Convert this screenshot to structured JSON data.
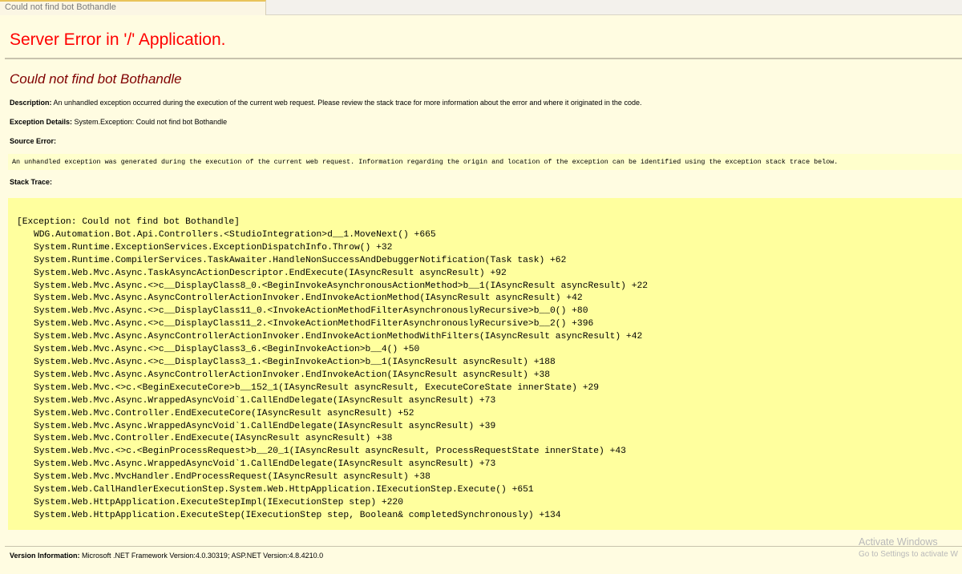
{
  "tab": {
    "title": "Could not find bot Bothandle"
  },
  "header": {
    "title": "Server Error in '/' Application."
  },
  "error": {
    "title": "Could not find bot Bothandle",
    "description_label": "Description:",
    "description_text": "An unhandled exception occurred during the execution of the current web request. Please review the stack trace for more information about the error and where it originated in the code.",
    "exception_label": "Exception Details:",
    "exception_text": "System.Exception: Could not find bot Bothandle",
    "source_label": "Source Error:",
    "source_text": "An unhandled exception was generated during the execution of the current web request. Information regarding the origin and location of the exception can be identified using the exception stack trace below.",
    "stack_label": "Stack Trace:"
  },
  "stack": {
    "header": "[Exception: Could not find bot Bothandle]",
    "lines": [
      "WDG.Automation.Bot.Api.Controllers.<StudioIntegration>d__1.MoveNext() +665",
      "System.Runtime.ExceptionServices.ExceptionDispatchInfo.Throw() +32",
      "System.Runtime.CompilerServices.TaskAwaiter.HandleNonSuccessAndDebuggerNotification(Task task) +62",
      "System.Web.Mvc.Async.TaskAsyncActionDescriptor.EndExecute(IAsyncResult asyncResult) +92",
      "System.Web.Mvc.Async.<>c__DisplayClass8_0.<BeginInvokeAsynchronousActionMethod>b__1(IAsyncResult asyncResult) +22",
      "System.Web.Mvc.Async.AsyncControllerActionInvoker.EndInvokeActionMethod(IAsyncResult asyncResult) +42",
      "System.Web.Mvc.Async.<>c__DisplayClass11_0.<InvokeActionMethodFilterAsynchronouslyRecursive>b__0() +80",
      "System.Web.Mvc.Async.<>c__DisplayClass11_2.<InvokeActionMethodFilterAsynchronouslyRecursive>b__2() +396",
      "System.Web.Mvc.Async.AsyncControllerActionInvoker.EndInvokeActionMethodWithFilters(IAsyncResult asyncResult) +42",
      "System.Web.Mvc.Async.<>c__DisplayClass3_6.<BeginInvokeAction>b__4() +50",
      "System.Web.Mvc.Async.<>c__DisplayClass3_1.<BeginInvokeAction>b__1(IAsyncResult asyncResult) +188",
      "System.Web.Mvc.Async.AsyncControllerActionInvoker.EndInvokeAction(IAsyncResult asyncResult) +38",
      "System.Web.Mvc.<>c.<BeginExecuteCore>b__152_1(IAsyncResult asyncResult, ExecuteCoreState innerState) +29",
      "System.Web.Mvc.Async.WrappedAsyncVoid`1.CallEndDelegate(IAsyncResult asyncResult) +73",
      "System.Web.Mvc.Controller.EndExecuteCore(IAsyncResult asyncResult) +52",
      "System.Web.Mvc.Async.WrappedAsyncVoid`1.CallEndDelegate(IAsyncResult asyncResult) +39",
      "System.Web.Mvc.Controller.EndExecute(IAsyncResult asyncResult) +38",
      "System.Web.Mvc.<>c.<BeginProcessRequest>b__20_1(IAsyncResult asyncResult, ProcessRequestState innerState) +43",
      "System.Web.Mvc.Async.WrappedAsyncVoid`1.CallEndDelegate(IAsyncResult asyncResult) +73",
      "System.Web.Mvc.MvcHandler.EndProcessRequest(IAsyncResult asyncResult) +38",
      "System.Web.CallHandlerExecutionStep.System.Web.HttpApplication.IExecutionStep.Execute() +651",
      "System.Web.HttpApplication.ExecuteStepImpl(IExecutionStep step) +220",
      "System.Web.HttpApplication.ExecuteStep(IExecutionStep step, Boolean& completedSynchronously) +134"
    ]
  },
  "version": {
    "label": "Version Information:",
    "text": "Microsoft .NET Framework Version:4.0.30319; ASP.NET Version:4.8.4210.0"
  },
  "watermark": {
    "line1": "Activate Windows",
    "line2": "Go to Settings to activate W"
  }
}
